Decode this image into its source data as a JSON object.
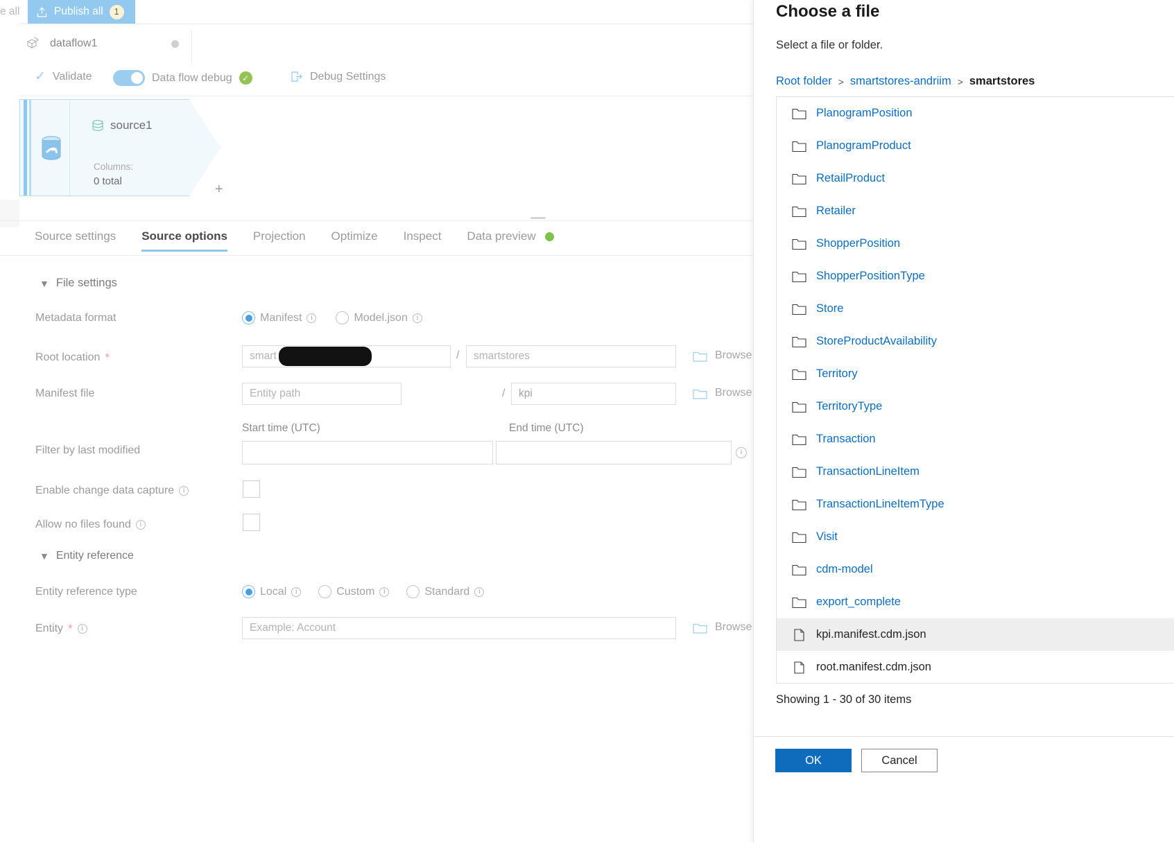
{
  "topbar": {
    "tab_all_label": "e all",
    "publish_label": "Publish all",
    "publish_count": "1",
    "publish_icon": "upload-icon"
  },
  "flowbar": {
    "name": "dataflow1",
    "icon": "dataflow-icon",
    "status_dot": "unsaved-dot"
  },
  "toolbar": {
    "validate_label": "Validate",
    "validate_icon": "check-icon",
    "debug_toggle_label": "Data flow debug",
    "debug_toggle_state": "on",
    "debug_status_icon": "green-check-icon",
    "debug_settings_label": "Debug Settings",
    "debug_settings_icon": "debug-settings-icon"
  },
  "canvas": {
    "node": {
      "title": "source1",
      "title_icon": "source-dataset-icon",
      "side_icon": "database-arrow-icon",
      "columns_label": "Columns:",
      "columns_value": "0 total",
      "add_label": "+"
    }
  },
  "tabs": [
    {
      "label": "Source settings",
      "active": false
    },
    {
      "label": "Source options",
      "active": true
    },
    {
      "label": "Projection",
      "active": false
    },
    {
      "label": "Optimize",
      "active": false
    },
    {
      "label": "Inspect",
      "active": false
    },
    {
      "label": "Data preview",
      "active": false,
      "dot": "green-status-dot"
    }
  ],
  "form": {
    "file_settings_label": "File settings",
    "metadata_format": {
      "label": "Metadata format",
      "options": [
        {
          "label": "Manifest",
          "selected": true,
          "info": true
        },
        {
          "label": "Model.json",
          "selected": false,
          "info": true
        }
      ]
    },
    "root_location": {
      "label": "Root location",
      "required": "*",
      "container_value": "smart",
      "container_redacted": true,
      "separator": "/",
      "folder_value": "smartstores",
      "browse_label": "Browse",
      "browse_icon": "folder-icon"
    },
    "manifest_file": {
      "label": "Manifest file",
      "path_placeholder": "Entity path",
      "separator": "/",
      "name_value": "kpi",
      "browse_label": "Browse",
      "browse_icon": "folder-icon"
    },
    "filter_last_modified": {
      "label": "Filter by last modified",
      "start_label": "Start time (UTC)",
      "end_label": "End time (UTC)",
      "start_value": "",
      "end_value": "",
      "info": true
    },
    "enable_cdc": {
      "label": "Enable change data capture",
      "checked": false,
      "info": true
    },
    "allow_no_files": {
      "label": "Allow no files found",
      "checked": false,
      "info": true
    },
    "entity_reference_label": "Entity reference",
    "entity_reference_type": {
      "label": "Entity reference type",
      "options": [
        {
          "label": "Local",
          "selected": true,
          "info": true
        },
        {
          "label": "Custom",
          "selected": false,
          "info": true
        },
        {
          "label": "Standard",
          "selected": false,
          "info": true
        }
      ]
    },
    "entity": {
      "label": "Entity",
      "required": "*",
      "info": true,
      "placeholder": "Example: Account",
      "browse_label": "Browse",
      "browse_icon": "folder-icon"
    }
  },
  "dialog": {
    "title": "Choose a file",
    "subtitle": "Select a file or folder.",
    "breadcrumb": [
      {
        "label": "Root folder",
        "current": false
      },
      {
        "label": "smartstores-andriim",
        "current": false
      },
      {
        "label": "smartstores",
        "current": true
      }
    ],
    "breadcrumb_separator": ">",
    "items": [
      {
        "name": "PlanogramPosition",
        "type": "folder",
        "selected": false
      },
      {
        "name": "PlanogramProduct",
        "type": "folder",
        "selected": false
      },
      {
        "name": "RetailProduct",
        "type": "folder",
        "selected": false
      },
      {
        "name": "Retailer",
        "type": "folder",
        "selected": false
      },
      {
        "name": "ShopperPosition",
        "type": "folder",
        "selected": false
      },
      {
        "name": "ShopperPositionType",
        "type": "folder",
        "selected": false
      },
      {
        "name": "Store",
        "type": "folder",
        "selected": false
      },
      {
        "name": "StoreProductAvailability",
        "type": "folder",
        "selected": false
      },
      {
        "name": "Territory",
        "type": "folder",
        "selected": false
      },
      {
        "name": "TerritoryType",
        "type": "folder",
        "selected": false
      },
      {
        "name": "Transaction",
        "type": "folder",
        "selected": false
      },
      {
        "name": "TransactionLineItem",
        "type": "folder",
        "selected": false
      },
      {
        "name": "TransactionLineItemType",
        "type": "folder",
        "selected": false
      },
      {
        "name": "Visit",
        "type": "folder",
        "selected": false
      },
      {
        "name": "cdm-model",
        "type": "folder",
        "selected": false
      },
      {
        "name": "export_complete",
        "type": "folder",
        "selected": false
      },
      {
        "name": "kpi.manifest.cdm.json",
        "type": "file",
        "selected": true
      },
      {
        "name": "root.manifest.cdm.json",
        "type": "file",
        "selected": false
      }
    ],
    "showing_text": "Showing 1 - 30 of 30 items",
    "ok_label": "OK",
    "cancel_label": "Cancel"
  },
  "colors": {
    "accent_blue": "#0f6cbd",
    "publish_bg": "#93c9ee",
    "toggle_on": "#9dcdee",
    "status_green": "#7cc24b",
    "tab_underline": "#8ec8ec"
  }
}
